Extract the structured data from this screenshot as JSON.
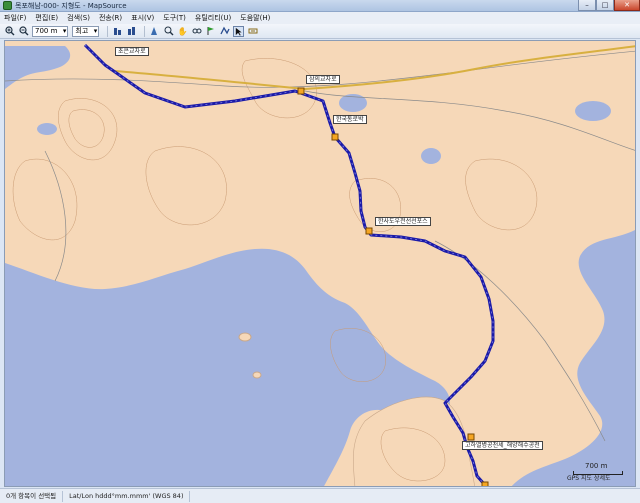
{
  "window": {
    "title": "목포해남-000- 지형도 - MapSource",
    "minimize": "–",
    "maximize": "□",
    "close": "✕"
  },
  "menu": [
    "파일(F)",
    "편집(E)",
    "검색(S)",
    "전송(R)",
    "표시(V)",
    "도구(T)",
    "유틸리티(U)",
    "도움말(H)"
  ],
  "toolbar": {
    "zoom_level": "700 m",
    "detail_level": "최고",
    "icons": [
      "zoom-in-icon",
      "zoom-out-icon",
      "waypoint-icon",
      "route-icon",
      "select-icon",
      "hand-icon",
      "distance-icon",
      "track-icon",
      "pointer-icon"
    ]
  },
  "map": {
    "labels": [
      "초은교차로",
      "삼의교차로",
      "한국통로박",
      "한사도우전선선포스",
      "고하열병공천세_해양해수공천"
    ],
    "route_color": "#1a1aa8",
    "land_color": "#f6d8b8",
    "water_color": "#a3b3de",
    "scale_text": "700 m",
    "attribution": "GPS 지도 상세도"
  },
  "status": {
    "selection": "0개 항목이 선택됨",
    "coord_format": "Lat/Lon hddd°mm.mmm' (WGS 84)"
  }
}
